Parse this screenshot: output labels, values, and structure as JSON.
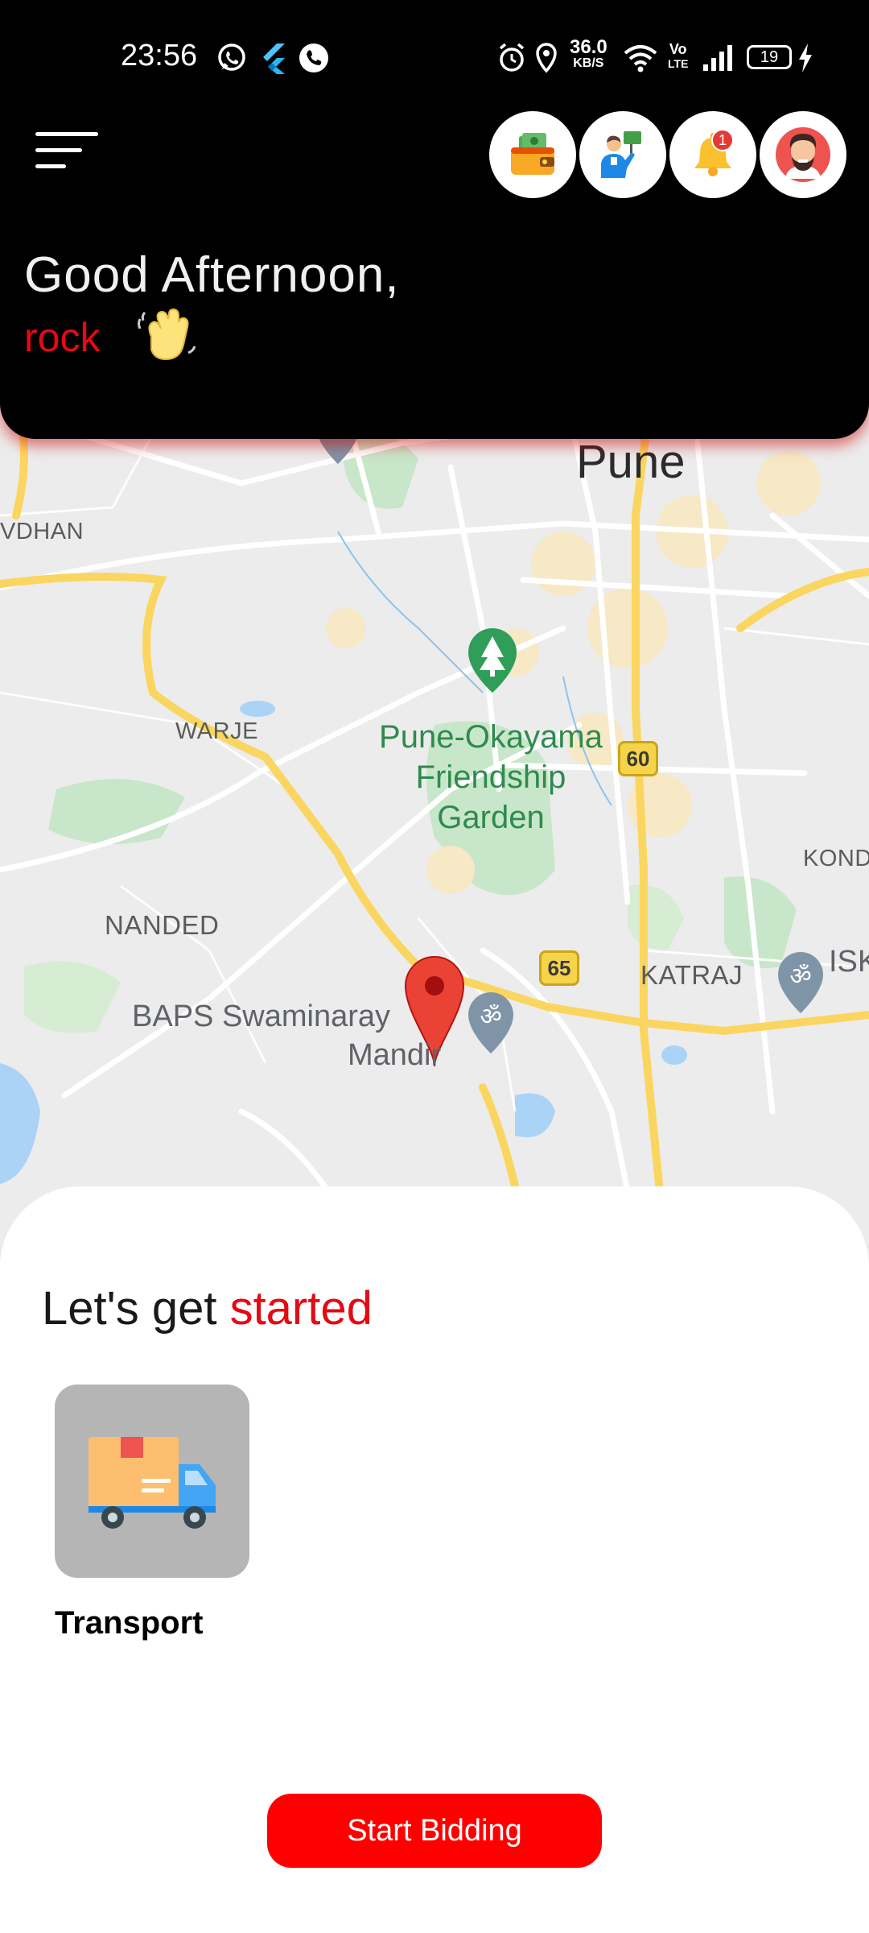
{
  "status_bar": {
    "time": "23:56",
    "net_speed_value": "36.0",
    "net_speed_unit": "KB/S",
    "volte_top": "Vo",
    "volte_bottom": "LTE",
    "battery": "19"
  },
  "header": {
    "menu_icon": "hamburger-menu-icon",
    "actions": [
      {
        "name": "wallet",
        "icon": "wallet-icon"
      },
      {
        "name": "agent",
        "icon": "agent-icon"
      },
      {
        "name": "notifications",
        "icon": "bell-icon",
        "badge": "1"
      },
      {
        "name": "profile",
        "icon": "avatar-icon"
      }
    ],
    "greeting": "Good Afternoon,",
    "username": "rock",
    "wave_icon": "waving-hand-icon"
  },
  "map": {
    "labels": {
      "city": "Pune",
      "area_left": "VDHAN",
      "warje": "WARJE",
      "nanded": "NANDED",
      "katraj": "KATRAJ",
      "kondh": "KONDH",
      "isk": "ISK",
      "park_line1": "Pune-Okayama",
      "park_line2": "Friendship",
      "park_line3": "Garden",
      "poi_line1": "BAPS Swaminaray",
      "poi_line2": "Mandir",
      "road_60": "60",
      "road_65": "65"
    },
    "marker_icon": "location-pin-icon"
  },
  "sheet": {
    "title_prefix": "Let's get ",
    "title_accent": "started",
    "service": {
      "label": "Transport",
      "icon": "delivery-truck-icon"
    },
    "cta_label": "Start Bidding"
  },
  "colors": {
    "accent": "#e50914",
    "cta": "#ff0000",
    "header_bg": "#000000",
    "map_bg": "#ececec"
  }
}
